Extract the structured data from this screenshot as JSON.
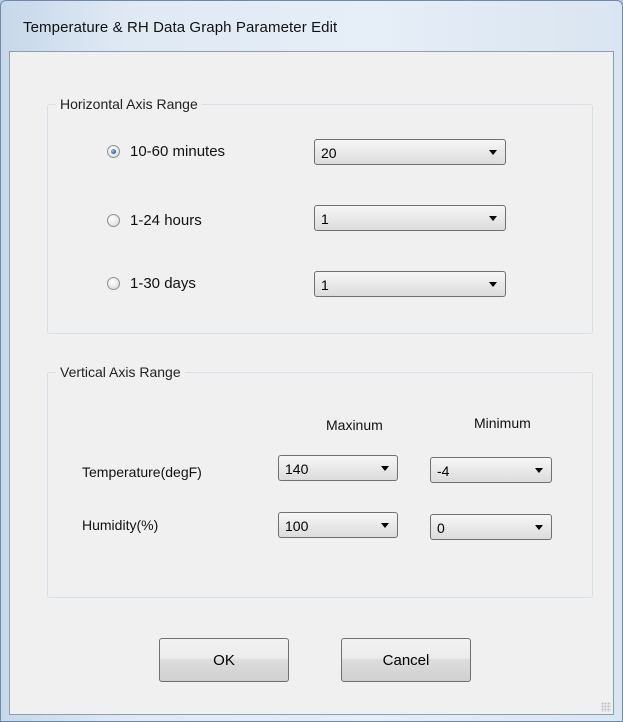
{
  "window": {
    "title": "Temperature & RH Data Graph Parameter Edit"
  },
  "horizontal": {
    "label": "Horizontal Axis Range",
    "options": [
      {
        "label": "10-60 minutes",
        "checked": true,
        "value": "20"
      },
      {
        "label": "1-24 hours",
        "checked": false,
        "value": "1"
      },
      {
        "label": "1-30 days",
        "checked": false,
        "value": "1"
      }
    ]
  },
  "vertical": {
    "label": "Vertical Axis Range",
    "max_header": "Maxinum",
    "min_header": "Minimum",
    "rows": [
      {
        "label": "Temperature(degF)",
        "max": "140",
        "min": "-4"
      },
      {
        "label": "Humidity(%)",
        "max": "100",
        "min": "0"
      }
    ]
  },
  "buttons": {
    "ok": "OK",
    "cancel": "Cancel"
  }
}
